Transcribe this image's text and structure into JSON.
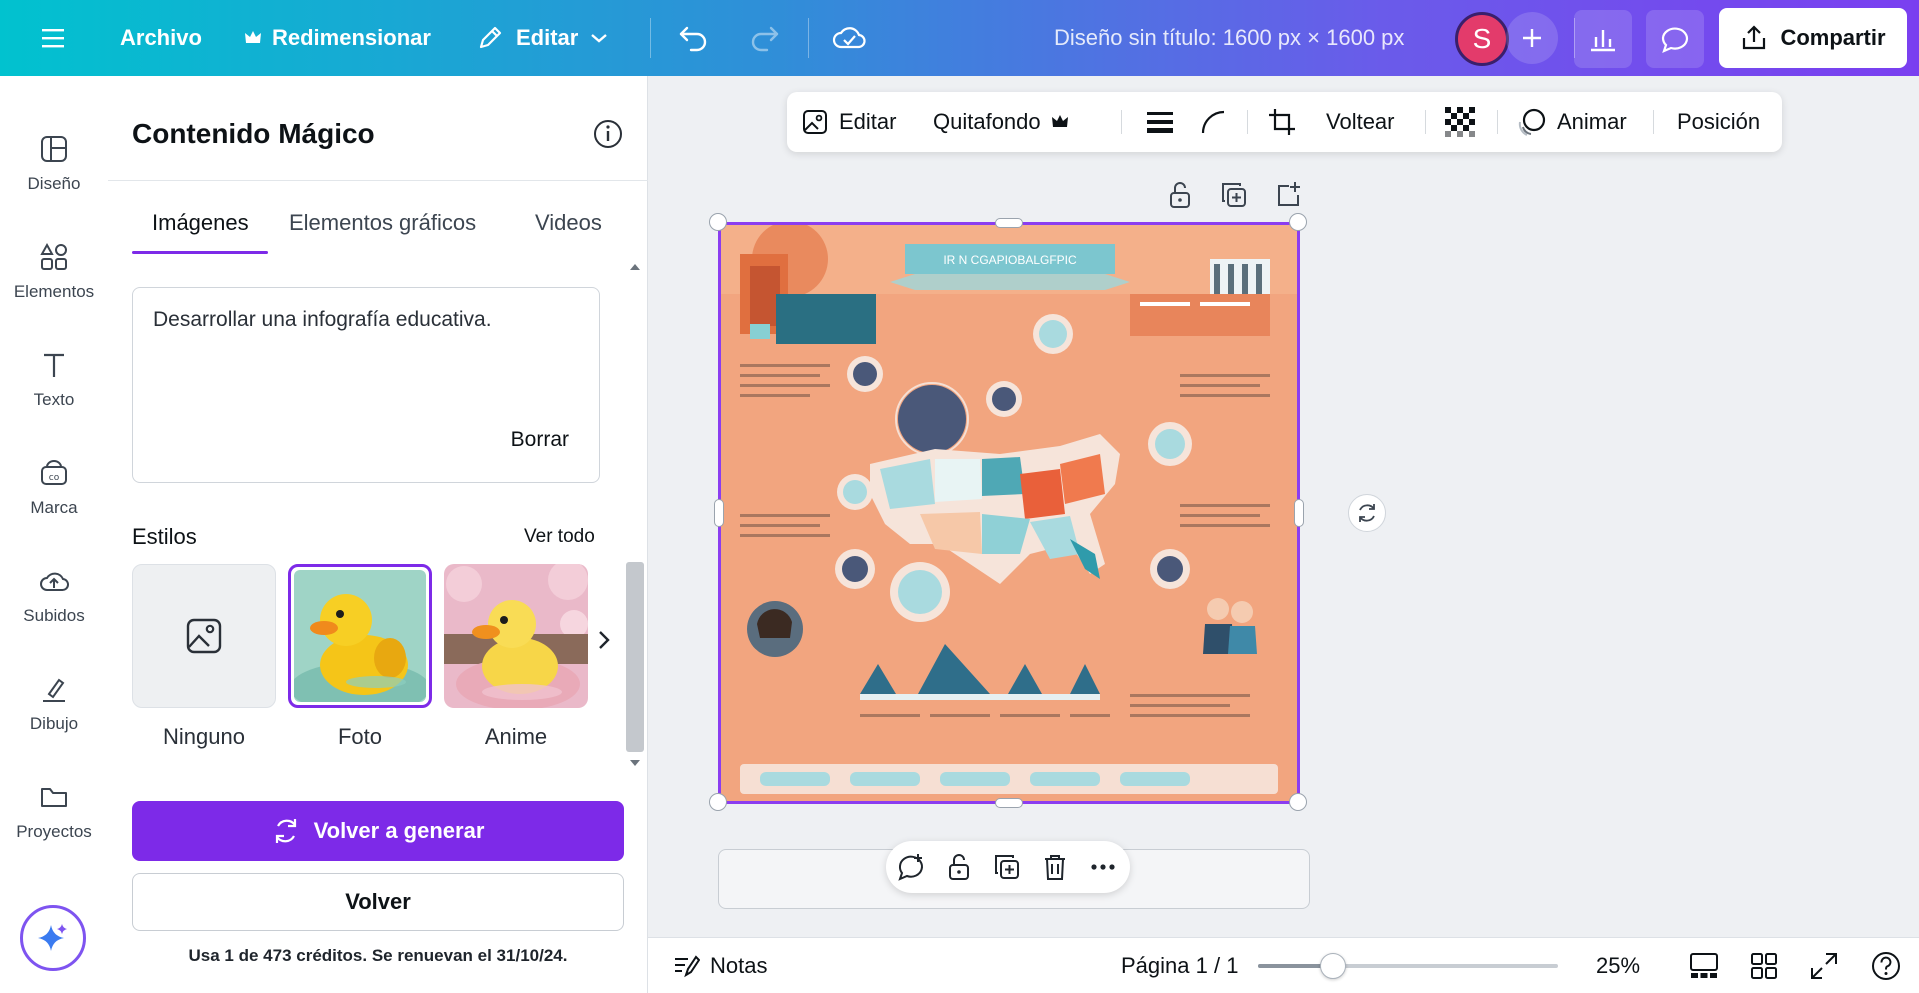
{
  "topbar": {
    "menu_icon": "hamburger-icon",
    "file_label": "Archivo",
    "resize_label": "Redimensionar",
    "edit_label": "Editar",
    "doc_title": "Diseño sin título: 1600 px × 1600 px",
    "avatar_initial": "S",
    "share_label": "Compartir"
  },
  "rail": {
    "items": [
      {
        "label": "Diseño",
        "icon": "design-icon"
      },
      {
        "label": "Elementos",
        "icon": "elements-icon"
      },
      {
        "label": "Texto",
        "icon": "text-icon"
      },
      {
        "label": "Marca",
        "icon": "brand-icon"
      },
      {
        "label": "Subidos",
        "icon": "upload-icon"
      },
      {
        "label": "Dibujo",
        "icon": "draw-icon"
      },
      {
        "label": "Proyectos",
        "icon": "folder-icon"
      }
    ]
  },
  "panel": {
    "title": "Contenido Mágico",
    "tabs": [
      {
        "label": "Imágenes",
        "active": true
      },
      {
        "label": "Elementos gráficos",
        "active": false
      },
      {
        "label": "Videos",
        "active": false
      }
    ],
    "prompt": {
      "value": "Desarrollar una infografía educativa.",
      "clear_label": "Borrar"
    },
    "styles": {
      "label": "Estilos",
      "see_all": "Ver todo",
      "items": [
        {
          "name": "Ninguno",
          "selected": false
        },
        {
          "name": "Foto",
          "selected": true
        },
        {
          "name": "Anime",
          "selected": false
        }
      ]
    },
    "regenerate_label": "Volver a generar",
    "back_label": "Volver",
    "credits_text": "Usa 1 de 473 créditos. Se renuevan el 31/10/24."
  },
  "context_toolbar": {
    "edit_label": "Editar",
    "bg_remover_label": "Quitafondo",
    "flip_label": "Voltear",
    "animate_label": "Animar",
    "position_label": "Posición"
  },
  "canvas": {
    "infographic_title": "IR N CGAPIOBALGFPIC"
  },
  "bottombar": {
    "notes_label": "Notas",
    "page_label": "Página 1 / 1",
    "zoom_label": "25%",
    "zoom_level": 0.25
  },
  "colors": {
    "accent": "#7d2ae8",
    "topbar_start": "#01c2cf",
    "topbar_end": "#7a3ff0",
    "canvas_bg": "#f4b08a"
  }
}
